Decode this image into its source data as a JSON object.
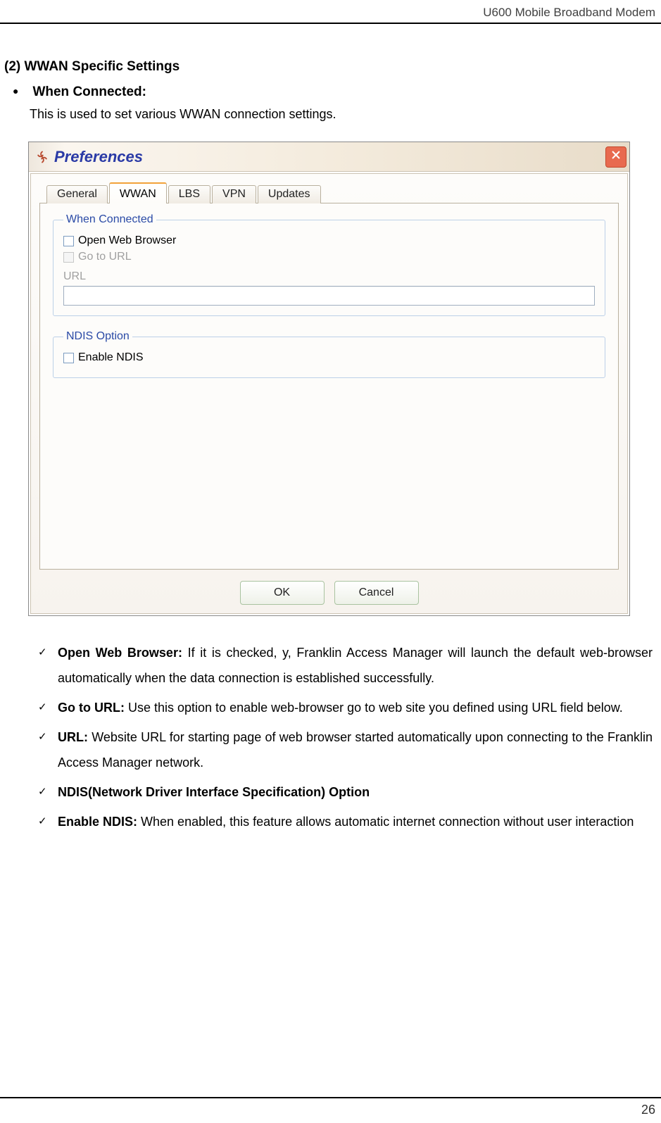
{
  "header": {
    "doc_title": "U600 Mobile Broadband Modem"
  },
  "section": {
    "heading": "(2) WWAN Specific Settings",
    "bullet_title": "When Connected:",
    "intro": "This is used to set various WWAN connection settings."
  },
  "dialog": {
    "title": "Preferences",
    "tabs": [
      "General",
      "WWAN",
      "LBS",
      "VPN",
      "Updates"
    ],
    "active_tab_index": 1,
    "group_when_connected": {
      "legend": "When Connected",
      "open_browser_label": "Open Web Browser",
      "go_to_url_label": "Go to URL",
      "url_label": "URL",
      "open_browser_checked": false,
      "go_to_url_checked": false,
      "url_value": ""
    },
    "group_ndis": {
      "legend": "NDIS Option",
      "enable_ndis_label": "Enable NDIS",
      "enable_ndis_checked": false
    },
    "buttons": {
      "ok": "OK",
      "cancel": "Cancel"
    }
  },
  "descriptions": {
    "items": [
      {
        "title": "Open Web Browser: ",
        "text": "If it is checked, y, Franklin Access Manager will launch the default web-browser automatically when the data connection is established successfully."
      },
      {
        "title": "Go to URL: ",
        "text": "Use this option to enable web-browser go to web site you defined using URL field below."
      },
      {
        "title": "URL: ",
        "text": "Website URL for starting page of web browser started automatically upon connecting to the Franklin Access Manager network."
      },
      {
        "title": "NDIS(Network Driver Interface Specification) Option",
        "text": ""
      },
      {
        "title": "Enable NDIS: ",
        "text": "When enabled, this feature allows automatic internet connection without user interaction"
      }
    ]
  },
  "footer": {
    "page_number": "26"
  }
}
